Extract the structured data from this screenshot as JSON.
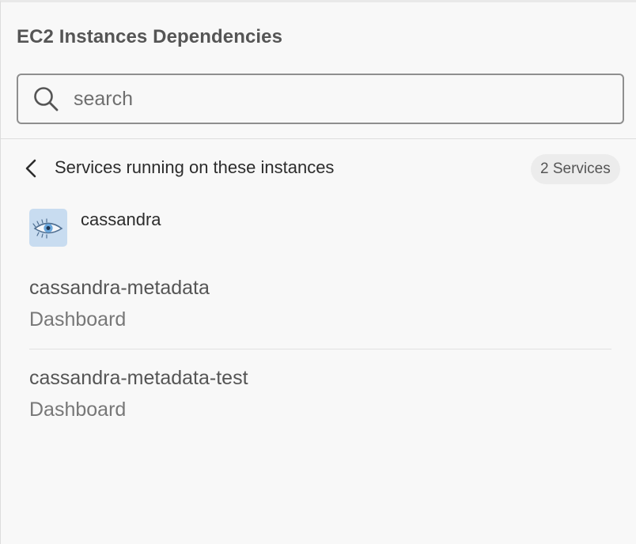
{
  "panel": {
    "title": "EC2 Instances Dependencies"
  },
  "search": {
    "placeholder": "search",
    "value": "",
    "icon": "search-icon"
  },
  "section": {
    "title": "Services running on these instances",
    "back_icon": "chevron-left-icon",
    "count_label": "2 Services"
  },
  "service": {
    "name": "cassandra",
    "logo": "cassandra-eye-logo",
    "logo_bg": "#c8dcf0"
  },
  "dashboards": [
    {
      "title": "cassandra-metadata",
      "type": "Dashboard"
    },
    {
      "title": "cassandra-metadata-test",
      "type": "Dashboard"
    }
  ]
}
